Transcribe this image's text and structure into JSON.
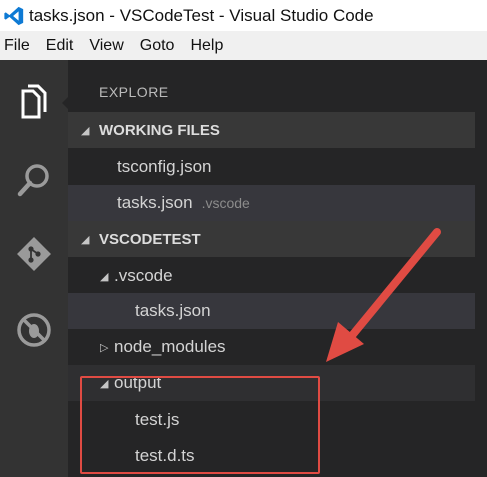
{
  "window": {
    "title": "tasks.json - VSCodeTest - Visual Studio Code"
  },
  "menu": {
    "items": [
      "File",
      "Edit",
      "View",
      "Goto",
      "Help"
    ]
  },
  "activity_bar": {
    "items": [
      {
        "icon": "files-icon",
        "active": true
      },
      {
        "icon": "search-icon",
        "active": false
      },
      {
        "icon": "git-icon",
        "active": false
      },
      {
        "icon": "debug-icon",
        "active": false
      }
    ]
  },
  "explorer": {
    "header": "EXPLORE",
    "working_files": {
      "title": "WORKING FILES",
      "files": [
        {
          "name": "tsconfig.json",
          "folder": ""
        },
        {
          "name": "tasks.json",
          "folder": ".vscode"
        }
      ]
    },
    "project": {
      "title": "VSCODETEST",
      "vscode_folder": ".vscode",
      "vscode_file": "tasks.json",
      "node_modules": "node_modules",
      "output_folder": "output",
      "output_files": [
        "test.js",
        "test.d.ts"
      ]
    }
  },
  "annotation": {
    "color": "#e04b43"
  },
  "colors": {
    "accent": "#0e7ad4",
    "sidebar_bg": "#252526",
    "activity_bg": "#333333",
    "section_bg": "#383838"
  }
}
